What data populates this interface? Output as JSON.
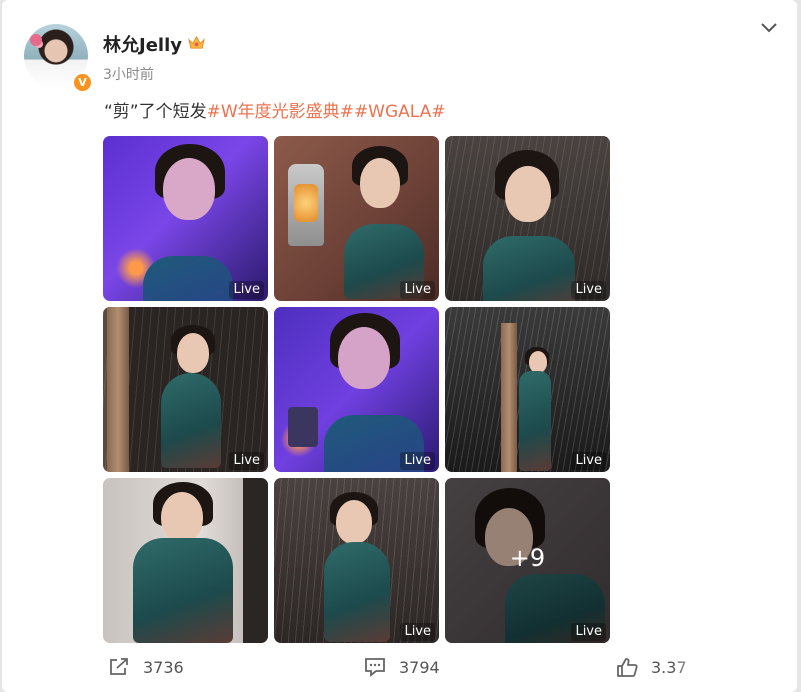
{
  "post": {
    "username": "林允Jelly",
    "timestamp": "3小时前",
    "text_plain": "“剪”了个短发",
    "hashtags": [
      "#W年度光影盛典#",
      "#WGALA#"
    ]
  },
  "gallery": {
    "live_label": "Live",
    "more_count": "+9",
    "tiles": [
      {
        "name": "photo-purple-closeup",
        "live": true
      },
      {
        "name": "photo-lantern",
        "live": true
      },
      {
        "name": "photo-rain-halter",
        "live": true
      },
      {
        "name": "photo-seated-rain",
        "live": true
      },
      {
        "name": "photo-purple-candle",
        "live": true
      },
      {
        "name": "photo-column-fullbody",
        "live": true
      },
      {
        "name": "photo-dress-portrait",
        "live": false
      },
      {
        "name": "photo-rain-standing",
        "live": true
      },
      {
        "name": "photo-last-more",
        "live": true
      }
    ]
  },
  "actions": {
    "repost_count": "3736",
    "comment_count": "3794",
    "like_count": "3.37"
  },
  "colors": {
    "hashtag": "#eb7350",
    "verified_badge": "#f7941d",
    "background": "#e6e6e6"
  }
}
